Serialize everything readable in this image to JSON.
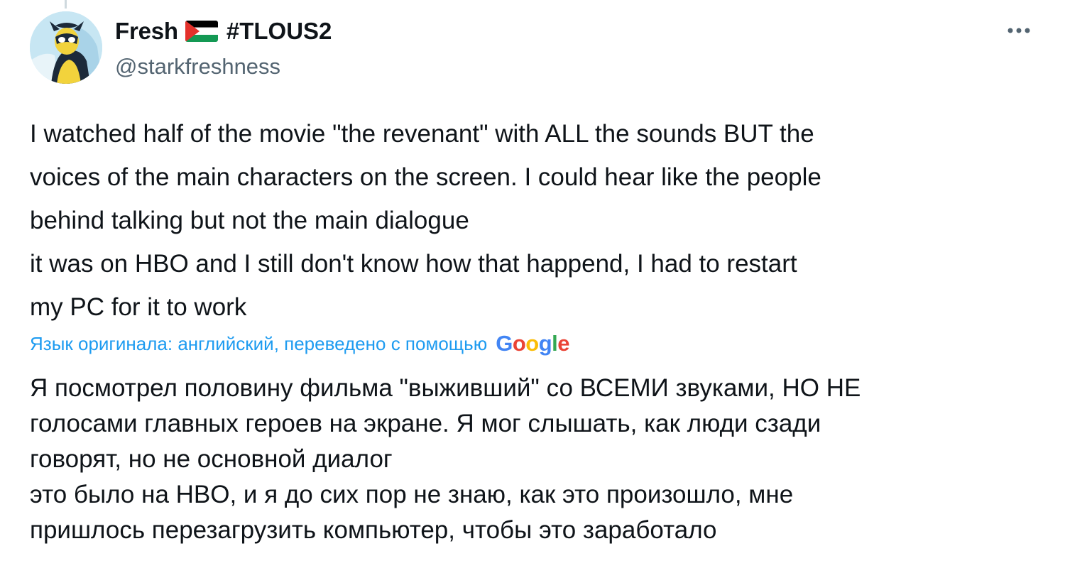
{
  "user": {
    "display_name": "Fresh",
    "flag_icon": "palestine-flag-icon",
    "hashtag": "#TLOUS2",
    "handle": "@starkfreshness"
  },
  "tweet": {
    "text": "I watched half of the movie \"the revenant\" with ALL the sounds BUT the\nvoices of the main characters on the screen. I could hear like the people\nbehind talking but not the main dialogue\nit was on HBO and I still don't know how that happend, I had to restart\nmy PC for it to work"
  },
  "translation": {
    "note": "Язык оригинала: английский, переведено с помощью",
    "provider": "Google",
    "text": "Я посмотрел половину фильма \"выживший\" со ВСЕМИ звуками, НО НЕ\nголосами главных героев на экране. Я мог слышать, как люди сзади\nговорят, но не основной диалог\nэто было на HBO, и я до сих пор не знаю, как это произошло, мне\nпришлось перезагрузить компьютер, чтобы это заработало"
  },
  "colors": {
    "text": "#0f1419",
    "secondary": "#536471",
    "link": "#1d9bf0",
    "google_blue": "#4285f4",
    "google_red": "#ea4335",
    "google_yellow": "#fbbc05",
    "google_green": "#34a853"
  }
}
